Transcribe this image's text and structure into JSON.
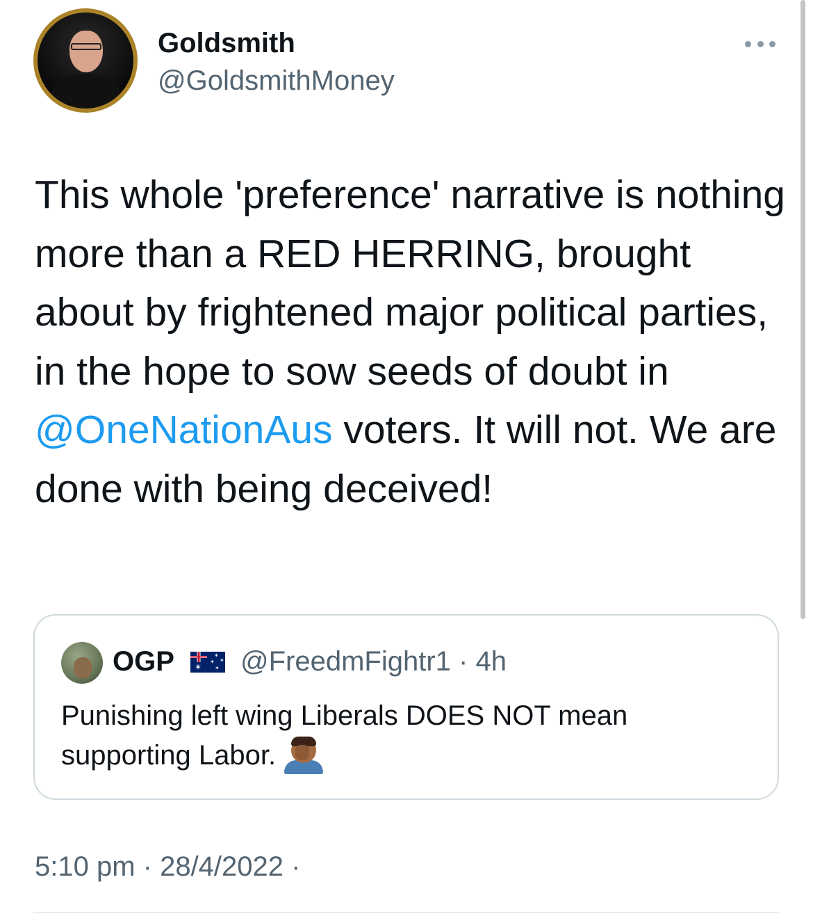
{
  "author": {
    "name": "Goldsmith",
    "handle": "@GoldsmithMoney"
  },
  "tweet": {
    "text_before_mention": "This whole 'preference' narrative is nothing more than a RED HERRING, brought about by frightened major political parties, in the hope to sow seeds of doubt in ",
    "mention": "@OneNationAus",
    "text_after_mention": " voters. It will not. We are done with being deceived!",
    "timestamp": "5:10 pm · 28/4/2022 ·"
  },
  "quoted_tweet": {
    "name": "OGP",
    "flag_icon": "australia-flag-icon",
    "handle_and_time": "@FreedmFightr1 · 4h",
    "text": "Punishing left wing Liberals DOES NOT mean supporting Labor.",
    "emoji_icon": "man-facepalming-icon"
  },
  "colors": {
    "text_primary": "#0f1419",
    "text_secondary": "#536471",
    "mention": "#1d9bf0",
    "border": "#cfd9de",
    "avatar_ring": "#c9a64a"
  }
}
